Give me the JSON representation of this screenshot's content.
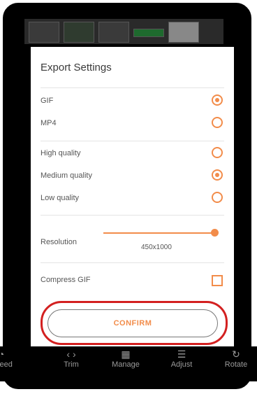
{
  "dialog": {
    "title": "Export Settings",
    "format": {
      "options": [
        {
          "label": "GIF",
          "selected": true
        },
        {
          "label": "MP4",
          "selected": false
        }
      ]
    },
    "quality": {
      "options": [
        {
          "label": "High quality",
          "selected": false
        },
        {
          "label": "Medium quality",
          "selected": true
        },
        {
          "label": "Low quality",
          "selected": false
        }
      ]
    },
    "resolution": {
      "label": "Resolution",
      "value": "450x1000",
      "slider_level": 1.0
    },
    "compress": {
      "label": "Compress GIF",
      "checked": false
    },
    "confirm_label": "CONFIRM"
  },
  "toolbar": {
    "items": [
      {
        "label": "Speed",
        "icon": "speed-icon"
      },
      {
        "label": "Trim",
        "icon": "trim-icon"
      },
      {
        "label": "Manage",
        "icon": "grid-icon"
      },
      {
        "label": "Adjust",
        "icon": "sliders-icon"
      },
      {
        "label": "Rotate",
        "icon": "rotate-icon"
      }
    ]
  },
  "colors": {
    "accent": "#f28c4a",
    "highlight_ring": "#d32020"
  }
}
